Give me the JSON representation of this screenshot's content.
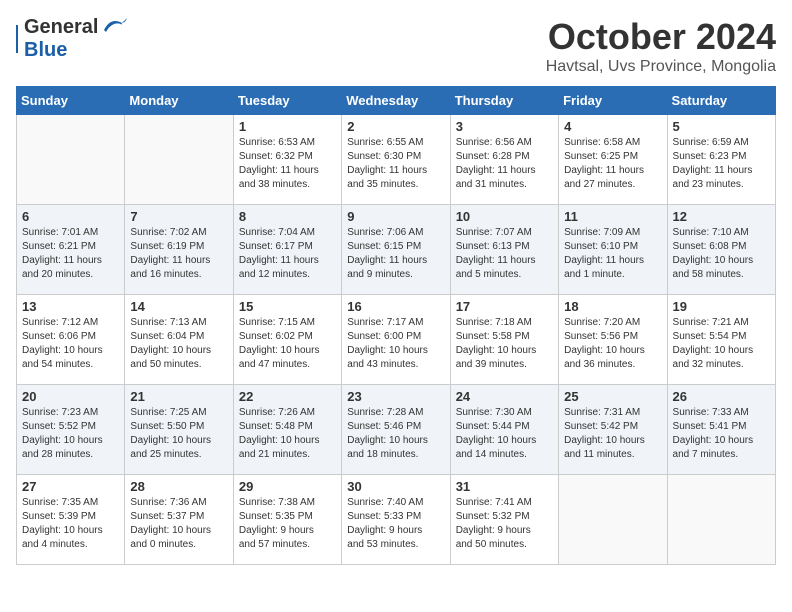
{
  "header": {
    "logo_general": "General",
    "logo_blue": "Blue",
    "month": "October 2024",
    "location": "Havtsal, Uvs Province, Mongolia"
  },
  "days_of_week": [
    "Sunday",
    "Monday",
    "Tuesday",
    "Wednesday",
    "Thursday",
    "Friday",
    "Saturday"
  ],
  "weeks": [
    [
      {
        "day": "",
        "detail": ""
      },
      {
        "day": "",
        "detail": ""
      },
      {
        "day": "1",
        "detail": "Sunrise: 6:53 AM\nSunset: 6:32 PM\nDaylight: 11 hours\nand 38 minutes."
      },
      {
        "day": "2",
        "detail": "Sunrise: 6:55 AM\nSunset: 6:30 PM\nDaylight: 11 hours\nand 35 minutes."
      },
      {
        "day": "3",
        "detail": "Sunrise: 6:56 AM\nSunset: 6:28 PM\nDaylight: 11 hours\nand 31 minutes."
      },
      {
        "day": "4",
        "detail": "Sunrise: 6:58 AM\nSunset: 6:25 PM\nDaylight: 11 hours\nand 27 minutes."
      },
      {
        "day": "5",
        "detail": "Sunrise: 6:59 AM\nSunset: 6:23 PM\nDaylight: 11 hours\nand 23 minutes."
      }
    ],
    [
      {
        "day": "6",
        "detail": "Sunrise: 7:01 AM\nSunset: 6:21 PM\nDaylight: 11 hours\nand 20 minutes."
      },
      {
        "day": "7",
        "detail": "Sunrise: 7:02 AM\nSunset: 6:19 PM\nDaylight: 11 hours\nand 16 minutes."
      },
      {
        "day": "8",
        "detail": "Sunrise: 7:04 AM\nSunset: 6:17 PM\nDaylight: 11 hours\nand 12 minutes."
      },
      {
        "day": "9",
        "detail": "Sunrise: 7:06 AM\nSunset: 6:15 PM\nDaylight: 11 hours\nand 9 minutes."
      },
      {
        "day": "10",
        "detail": "Sunrise: 7:07 AM\nSunset: 6:13 PM\nDaylight: 11 hours\nand 5 minutes."
      },
      {
        "day": "11",
        "detail": "Sunrise: 7:09 AM\nSunset: 6:10 PM\nDaylight: 11 hours\nand 1 minute."
      },
      {
        "day": "12",
        "detail": "Sunrise: 7:10 AM\nSunset: 6:08 PM\nDaylight: 10 hours\nand 58 minutes."
      }
    ],
    [
      {
        "day": "13",
        "detail": "Sunrise: 7:12 AM\nSunset: 6:06 PM\nDaylight: 10 hours\nand 54 minutes."
      },
      {
        "day": "14",
        "detail": "Sunrise: 7:13 AM\nSunset: 6:04 PM\nDaylight: 10 hours\nand 50 minutes."
      },
      {
        "day": "15",
        "detail": "Sunrise: 7:15 AM\nSunset: 6:02 PM\nDaylight: 10 hours\nand 47 minutes."
      },
      {
        "day": "16",
        "detail": "Sunrise: 7:17 AM\nSunset: 6:00 PM\nDaylight: 10 hours\nand 43 minutes."
      },
      {
        "day": "17",
        "detail": "Sunrise: 7:18 AM\nSunset: 5:58 PM\nDaylight: 10 hours\nand 39 minutes."
      },
      {
        "day": "18",
        "detail": "Sunrise: 7:20 AM\nSunset: 5:56 PM\nDaylight: 10 hours\nand 36 minutes."
      },
      {
        "day": "19",
        "detail": "Sunrise: 7:21 AM\nSunset: 5:54 PM\nDaylight: 10 hours\nand 32 minutes."
      }
    ],
    [
      {
        "day": "20",
        "detail": "Sunrise: 7:23 AM\nSunset: 5:52 PM\nDaylight: 10 hours\nand 28 minutes."
      },
      {
        "day": "21",
        "detail": "Sunrise: 7:25 AM\nSunset: 5:50 PM\nDaylight: 10 hours\nand 25 minutes."
      },
      {
        "day": "22",
        "detail": "Sunrise: 7:26 AM\nSunset: 5:48 PM\nDaylight: 10 hours\nand 21 minutes."
      },
      {
        "day": "23",
        "detail": "Sunrise: 7:28 AM\nSunset: 5:46 PM\nDaylight: 10 hours\nand 18 minutes."
      },
      {
        "day": "24",
        "detail": "Sunrise: 7:30 AM\nSunset: 5:44 PM\nDaylight: 10 hours\nand 14 minutes."
      },
      {
        "day": "25",
        "detail": "Sunrise: 7:31 AM\nSunset: 5:42 PM\nDaylight: 10 hours\nand 11 minutes."
      },
      {
        "day": "26",
        "detail": "Sunrise: 7:33 AM\nSunset: 5:41 PM\nDaylight: 10 hours\nand 7 minutes."
      }
    ],
    [
      {
        "day": "27",
        "detail": "Sunrise: 7:35 AM\nSunset: 5:39 PM\nDaylight: 10 hours\nand 4 minutes."
      },
      {
        "day": "28",
        "detail": "Sunrise: 7:36 AM\nSunset: 5:37 PM\nDaylight: 10 hours\nand 0 minutes."
      },
      {
        "day": "29",
        "detail": "Sunrise: 7:38 AM\nSunset: 5:35 PM\nDaylight: 9 hours\nand 57 minutes."
      },
      {
        "day": "30",
        "detail": "Sunrise: 7:40 AM\nSunset: 5:33 PM\nDaylight: 9 hours\nand 53 minutes."
      },
      {
        "day": "31",
        "detail": "Sunrise: 7:41 AM\nSunset: 5:32 PM\nDaylight: 9 hours\nand 50 minutes."
      },
      {
        "day": "",
        "detail": ""
      },
      {
        "day": "",
        "detail": ""
      }
    ]
  ]
}
